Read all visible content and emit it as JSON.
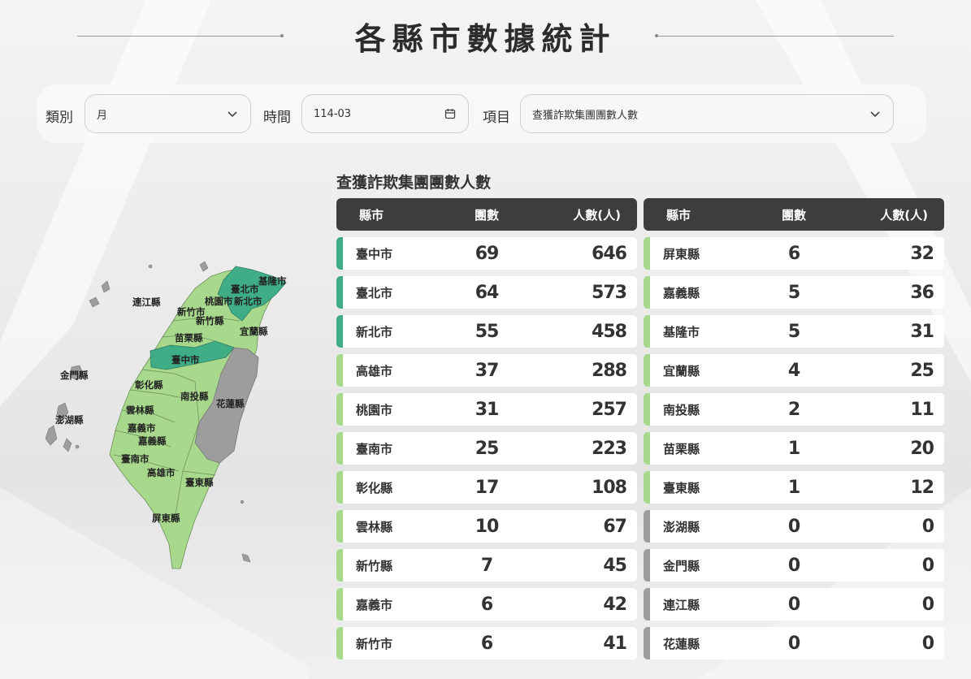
{
  "page": {
    "title": "各縣市數據統計"
  },
  "filters": {
    "category_label": "類別",
    "category_value": "月",
    "time_label": "時間",
    "time_value": "114-03",
    "item_label": "項目",
    "item_value": "查獲詐欺集團團數人數"
  },
  "table": {
    "title": "查獲詐欺集團團數人數",
    "headers": {
      "county": "縣市",
      "groups": "團數",
      "people": "人數(人)"
    },
    "left_rows": [
      {
        "county": "臺中市",
        "groups": "69",
        "people": "646",
        "level": 3
      },
      {
        "county": "臺北市",
        "groups": "64",
        "people": "573",
        "level": 3
      },
      {
        "county": "新北市",
        "groups": "55",
        "people": "458",
        "level": 3
      },
      {
        "county": "高雄市",
        "groups": "37",
        "people": "288",
        "level": 2
      },
      {
        "county": "桃園市",
        "groups": "31",
        "people": "257",
        "level": 2
      },
      {
        "county": "臺南市",
        "groups": "25",
        "people": "223",
        "level": 2
      },
      {
        "county": "彰化縣",
        "groups": "17",
        "people": "108",
        "level": 2
      },
      {
        "county": "雲林縣",
        "groups": "10",
        "people": "67",
        "level": 2
      },
      {
        "county": "新竹縣",
        "groups": "7",
        "people": "45",
        "level": 2
      },
      {
        "county": "嘉義市",
        "groups": "6",
        "people": "42",
        "level": 2
      },
      {
        "county": "新竹市",
        "groups": "6",
        "people": "41",
        "level": 2
      }
    ],
    "right_rows": [
      {
        "county": "屏東縣",
        "groups": "6",
        "people": "32",
        "level": 2
      },
      {
        "county": "嘉義縣",
        "groups": "5",
        "people": "36",
        "level": 2
      },
      {
        "county": "基隆市",
        "groups": "5",
        "people": "31",
        "level": 2
      },
      {
        "county": "宜蘭縣",
        "groups": "4",
        "people": "25",
        "level": 2
      },
      {
        "county": "南投縣",
        "groups": "2",
        "people": "11",
        "level": 2
      },
      {
        "county": "苗栗縣",
        "groups": "1",
        "people": "20",
        "level": 2
      },
      {
        "county": "臺東縣",
        "groups": "1",
        "people": "12",
        "level": 2
      },
      {
        "county": "澎湖縣",
        "groups": "0",
        "people": "0",
        "level": 0
      },
      {
        "county": "金門縣",
        "groups": "0",
        "people": "0",
        "level": 0
      },
      {
        "county": "連江縣",
        "groups": "0",
        "people": "0",
        "level": 0
      },
      {
        "county": "花蓮縣",
        "groups": "0",
        "people": "0",
        "level": 0
      }
    ]
  },
  "map": {
    "labels": [
      "基隆市",
      "臺北市",
      "新北市",
      "連江縣",
      "新竹市",
      "桃園市",
      "新竹縣",
      "苗栗縣",
      "宜蘭縣",
      "臺中市",
      "金門縣",
      "彰化縣",
      "南投縣",
      "花蓮縣",
      "雲林縣",
      "澎湖縣",
      "嘉義市",
      "嘉義縣",
      "臺南市",
      "高雄市",
      "臺東縣",
      "屏東縣"
    ]
  },
  "colors": {
    "level_high": "#3fae86",
    "level_mid": "#a8d88c",
    "level_zero": "#9d9d9d",
    "header_bg": "#3d3d3d"
  }
}
